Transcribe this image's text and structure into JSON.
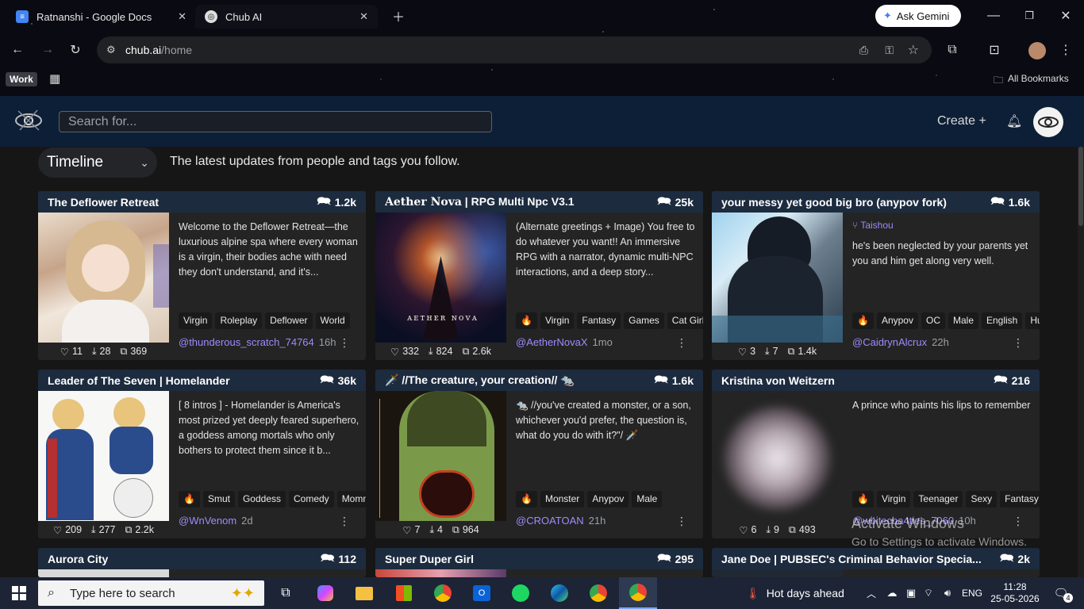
{
  "browser": {
    "tabs": [
      {
        "title": "Ratnanshi - Google Docs",
        "icon": "google-docs-icon"
      },
      {
        "title": "Chub AI",
        "icon": "chub-ai-icon"
      }
    ],
    "ask_gemini": "Ask Gemini",
    "url_host": "chub.ai",
    "url_path": "/home",
    "profile_group": "Work",
    "all_bookmarks": "All Bookmarks"
  },
  "site": {
    "search_placeholder": "Search for...",
    "create_label": "Create +",
    "timeline_label": "Timeline",
    "timeline_subtitle": "The latest updates from people and tags you follow."
  },
  "cards": [
    {
      "title": "The Deflower Retreat",
      "count": "1.2k",
      "desc": "Welcome to the Deflower Retreat—the luxurious alpine spa where every woman is a virgin, their bodies ache with need they don't understand, and it's...",
      "tags": [
        "Virgin",
        "Roleplay",
        "Deflower",
        "World"
      ],
      "likes": "11",
      "downloads": "28",
      "chats": "369",
      "author": "@thunderous_scratch_74764",
      "ago": "16h"
    },
    {
      "title_bold": "𝐀𝐞𝐭𝐡𝐞𝐫 𝐍𝐨𝐯𝐚",
      "title": " | RPG Multi Npc V3.1",
      "count": "25k",
      "desc": "(Alternate greetings + Image) You free to do whatever you want!! An immersive RPG with a narrator, dynamic multi-NPC interactions, and a deep story...",
      "tags": [
        "🔥",
        "Virgin",
        "Fantasy",
        "Games",
        "Cat Girl"
      ],
      "likes": "332",
      "downloads": "824",
      "chats": "2.6k",
      "author": "@AetherNovaX",
      "ago": "1mo"
    },
    {
      "title": "your messy yet good big bro (anypov fork)",
      "count": "1.6k",
      "fork_of": "Taishou",
      "desc": "he's been neglected by your parents yet you and him get along very well.",
      "tags": [
        "🔥",
        "Anypov",
        "OC",
        "Male",
        "English",
        "Hu"
      ],
      "likes": "3",
      "downloads": "7",
      "chats": "1.4k",
      "author": "@CaidrynAlcrux",
      "ago": "22h"
    },
    {
      "title": "Leader of The Seven | Homelander",
      "count": "36k",
      "desc": "[ 8 intros ] - Homelander is America's most prized yet deeply feared superhero, a goddess among mortals who only bothers to protect them since it b...",
      "tags": [
        "🔥",
        "Smut",
        "Goddess",
        "Comedy",
        "Momm"
      ],
      "likes": "209",
      "downloads": "277",
      "chats": "2.2k",
      "author": "@WnVenom",
      "ago": "2d"
    },
    {
      "title": "🗡️ //The creature, your creation// 🐀",
      "count": "1.6k",
      "desc": "🐀 //you've created a monster, or a son, whichever you'd prefer, the question is, what do you do with it?\"/ 🗡️",
      "tags": [
        "🔥",
        "Monster",
        "Anypov",
        "Male"
      ],
      "likes": "7",
      "downloads": "4",
      "chats": "964",
      "author": "@CROATOAN",
      "ago": "21h"
    },
    {
      "title": "Kristina von Weitzern",
      "count": "216",
      "desc": "A prince who paints his lips to remember",
      "tags": [
        "🔥",
        "Virgin",
        "Teenager",
        "Sexy",
        "Fantasy"
      ],
      "likes": "6",
      "downloads": "9",
      "chats": "493",
      "author": "@wbitecba4ties_7060",
      "ago": "10h"
    },
    {
      "title": "Aurora City",
      "count": "112"
    },
    {
      "title": "Super Duper Girl",
      "count": "295"
    },
    {
      "title": "Jane Doe | PUBSEC's Criminal Behavior Specia...",
      "count": "2k"
    }
  ],
  "windows": {
    "activate_title": "Activate Windows",
    "activate_sub": "Go to Settings to activate Windows."
  },
  "taskbar": {
    "search_placeholder": "Type here to search",
    "weather": "Hot days ahead",
    "lang": "ENG",
    "time": "11:28",
    "date": "25-05-2026",
    "notification_count": "4"
  }
}
